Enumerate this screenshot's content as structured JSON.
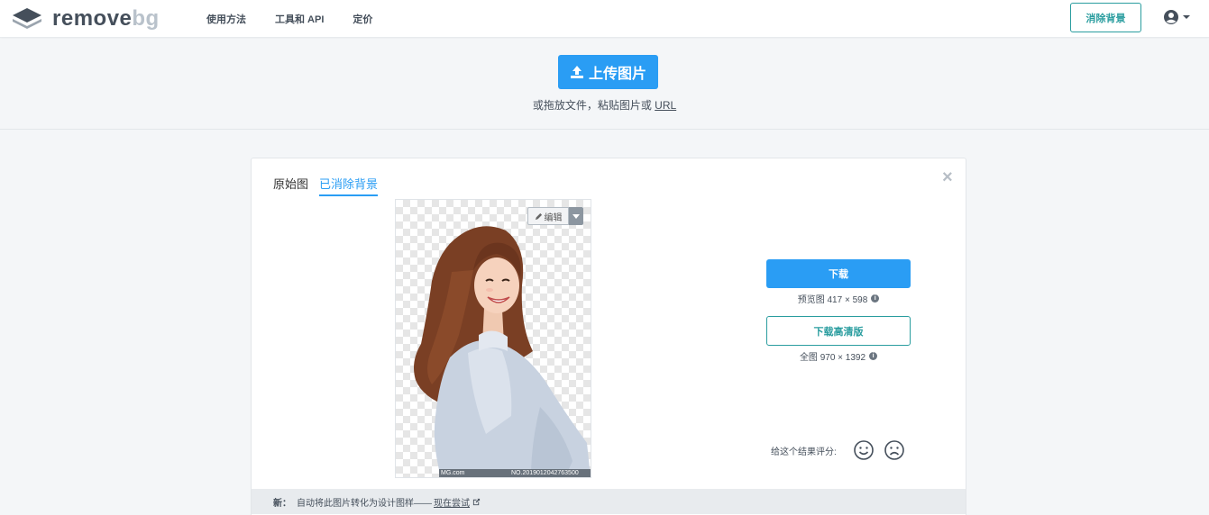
{
  "header": {
    "logo": {
      "word1": "remove",
      "word2": "bg"
    },
    "nav": [
      "使用方法",
      "工具和 API",
      "定价"
    ],
    "cta_label": "消除背景",
    "user_icon": "user-circle-icon"
  },
  "upload": {
    "button_label": "上传图片",
    "hint_text": "或拖放文件，粘贴图片或",
    "hint_link": "URL"
  },
  "result": {
    "tabs": [
      "原始图",
      "已消除背景"
    ],
    "active_tab": 1,
    "close_symbol": "×",
    "edit_label": "编辑",
    "watermark_left": "MG.com",
    "watermark_right": "NO.2019012042763500",
    "download_label": "下载",
    "preview_info": "预览图 417 × 598",
    "download_hd_label": "下载高清版",
    "full_info": "全图 970 × 1392",
    "rating_label": "给这个结果评分:",
    "footer_prefix": "新：",
    "footer_text": "自动将此图片转化为设计图样——",
    "footer_link": "现在尝试"
  },
  "colors": {
    "primary_blue": "#2a9df4",
    "teal": "#2a9d9f",
    "dark_text": "#454f5b"
  }
}
